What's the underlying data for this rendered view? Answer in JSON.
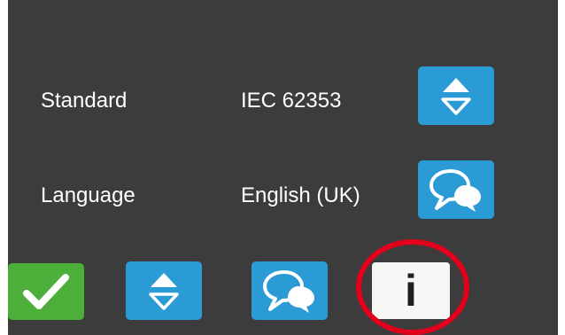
{
  "settings": {
    "rows": [
      {
        "label": "Standard",
        "value": "IEC 62353",
        "action_icon": "up-down-arrows-icon"
      },
      {
        "label": "Language",
        "value": "English (UK)",
        "action_icon": "speech-bubbles-icon"
      }
    ]
  },
  "toolbar": {
    "buttons": [
      {
        "name": "confirm",
        "icon": "checkmark-icon"
      },
      {
        "name": "standard-select",
        "icon": "up-down-arrows-icon"
      },
      {
        "name": "language-select",
        "icon": "speech-bubbles-icon"
      },
      {
        "name": "info",
        "icon": "info-icon",
        "glyph": "i"
      }
    ]
  },
  "colors": {
    "screen_background": "#3c3c3c",
    "button_blue": "#2b9bd6",
    "button_green": "#4caf3a",
    "info_button_background": "#f7f7f5",
    "highlight_ring": "#e3001b",
    "text": "#ffffff"
  }
}
